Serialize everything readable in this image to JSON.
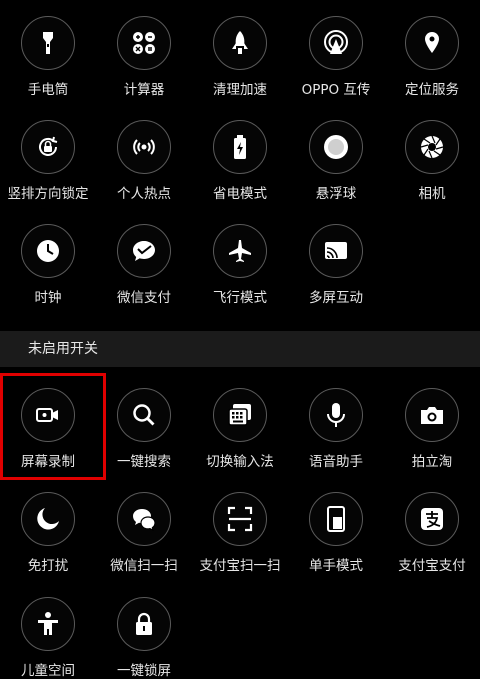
{
  "enabled_tiles": [
    {
      "label": "手电筒",
      "icon": "flashlight-icon"
    },
    {
      "label": "计算器",
      "icon": "calculator-icon"
    },
    {
      "label": "清理加速",
      "icon": "rocket-icon"
    },
    {
      "label": "OPPO 互传",
      "icon": "oppo-share-icon"
    },
    {
      "label": "定位服务",
      "icon": "location-pin-icon"
    },
    {
      "label": "竖排方向锁定",
      "icon": "rotation-lock-icon"
    },
    {
      "label": "个人热点",
      "icon": "hotspot-icon"
    },
    {
      "label": "省电模式",
      "icon": "battery-saver-icon"
    },
    {
      "label": "悬浮球",
      "icon": "floating-ball-icon"
    },
    {
      "label": "相机",
      "icon": "camera-aperture-icon"
    },
    {
      "label": "时钟",
      "icon": "clock-icon"
    },
    {
      "label": "微信支付",
      "icon": "wechat-pay-icon"
    },
    {
      "label": "飞行模式",
      "icon": "airplane-icon"
    },
    {
      "label": "多屏互动",
      "icon": "screen-cast-icon"
    }
  ],
  "section": {
    "title": "未启用开关"
  },
  "disabled_tiles": [
    {
      "label": "屏幕录制",
      "icon": "screen-record-icon"
    },
    {
      "label": "一键搜索",
      "icon": "search-icon"
    },
    {
      "label": "切换输入法",
      "icon": "keyboard-icon"
    },
    {
      "label": "语音助手",
      "icon": "microphone-icon"
    },
    {
      "label": "拍立淘",
      "icon": "photo-camera-icon"
    },
    {
      "label": "免打扰",
      "icon": "moon-icon"
    },
    {
      "label": "微信扫一扫",
      "icon": "wechat-scan-icon"
    },
    {
      "label": "支付宝扫一扫",
      "icon": "scan-frame-icon"
    },
    {
      "label": "单手模式",
      "icon": "one-hand-mode-icon"
    },
    {
      "label": "支付宝支付",
      "icon": "alipay-icon"
    },
    {
      "label": "儿童空间",
      "icon": "kid-space-icon"
    },
    {
      "label": "一键锁屏",
      "icon": "lock-icon"
    }
  ],
  "colors": {
    "highlight": "#e00000",
    "background": "#000000",
    "section_bg": "#1b1b1b"
  }
}
